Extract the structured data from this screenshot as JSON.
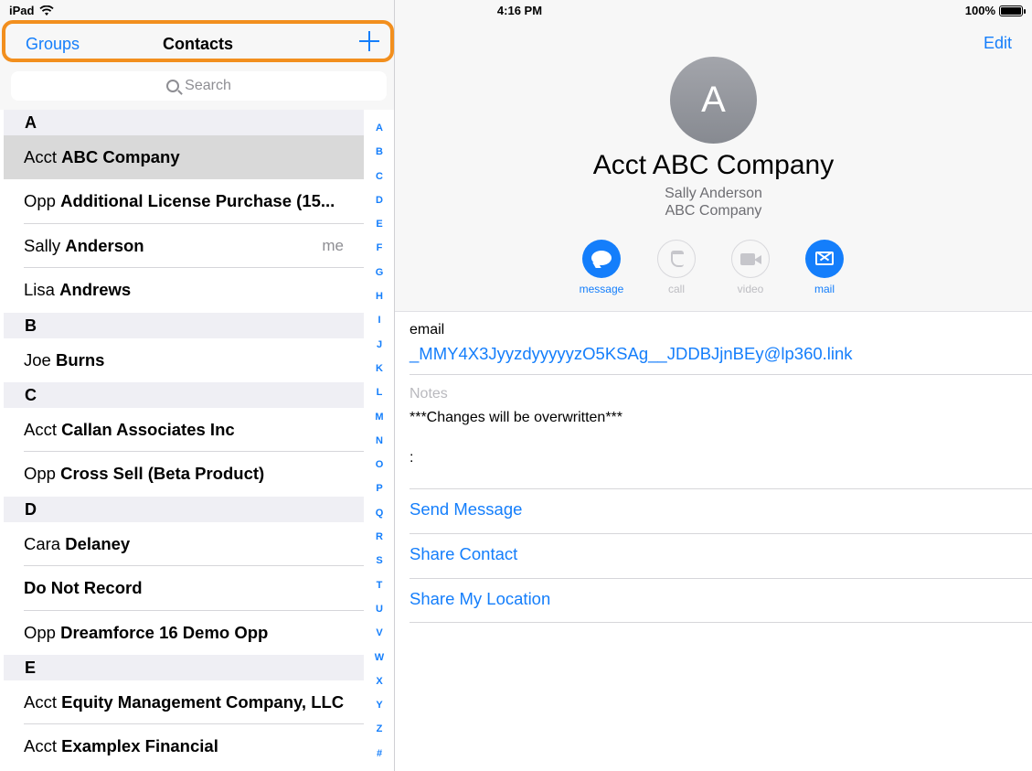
{
  "status": {
    "device": "iPad",
    "time": "4:16 PM",
    "battery": "100%"
  },
  "nav": {
    "groups_label": "Groups",
    "title": "Contacts"
  },
  "search": {
    "placeholder": "Search"
  },
  "list": {
    "section_a": "A",
    "section_b": "B",
    "section_c": "C",
    "section_d": "D",
    "section_e": "E",
    "rows": [
      {
        "first": "Acct ",
        "last": "ABC Company"
      },
      {
        "first": "Opp ",
        "last": "Additional License Purchase (15..."
      },
      {
        "first": "Sally ",
        "last": "Anderson",
        "tag": "me"
      },
      {
        "first": "Lisa ",
        "last": "Andrews"
      },
      {
        "first": "Joe ",
        "last": "Burns"
      },
      {
        "first": "Acct ",
        "last": "Callan Associates Inc"
      },
      {
        "first": "Opp ",
        "last": "Cross Sell (Beta Product)"
      },
      {
        "first": "Cara ",
        "last": "Delaney"
      },
      {
        "first": "",
        "last": "Do Not Record"
      },
      {
        "first": "Opp ",
        "last": "Dreamforce 16 Demo Opp"
      },
      {
        "first": "Acct ",
        "last": "Equity Management Company, LLC"
      },
      {
        "first": "Acct ",
        "last": "Examplex Financial"
      }
    ]
  },
  "index_letters": [
    "A",
    "B",
    "C",
    "D",
    "E",
    "F",
    "G",
    "H",
    "I",
    "J",
    "K",
    "L",
    "M",
    "N",
    "O",
    "P",
    "Q",
    "R",
    "S",
    "T",
    "U",
    "V",
    "W",
    "X",
    "Y",
    "Z",
    "#"
  ],
  "detail": {
    "edit_label": "Edit",
    "avatar_initial": "A",
    "name": "Acct ABC Company",
    "subtitle1": "Sally Anderson",
    "subtitle2": "ABC Company",
    "actions": {
      "message": "message",
      "call": "call",
      "video": "video",
      "mail": "mail"
    },
    "email_label": "email",
    "email_value": "_MMY4X3JyyzdyyyyyzO5KSAg__JDDBJjnBEy@lp360.link",
    "notes_label": "Notes",
    "notes_value": "***Changes will be overwritten***",
    "notes_colon": ":",
    "send_message": "Send Message",
    "share_contact": "Share Contact",
    "share_location": "Share My Location"
  },
  "colors": {
    "accent": "#147efb",
    "highlight": "#f28f1e"
  }
}
